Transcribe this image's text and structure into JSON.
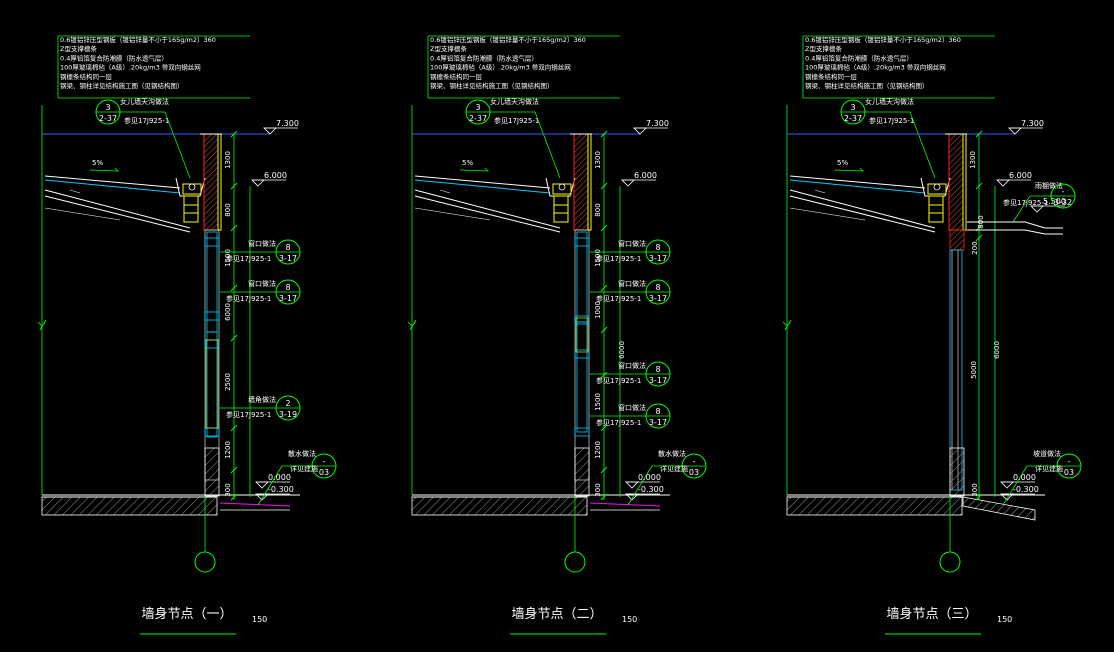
{
  "panels": [
    {
      "title": "墙身节点（一）",
      "scale": "150",
      "notes": [
        "0.6镀铝锌压型钢板（镀铝锌量不小于165g/m2）360",
        "Z型支撑檩条",
        "0.4厚铝箔复合防潮膜（防水透气层）",
        "100厚玻璃棉毡（A级）.20kg/m3  带双向钢丝网",
        "钢檩条结构同一层",
        "钢梁、钢柱详见结构施工图（见钢结构图）"
      ],
      "top_callout": {
        "num": "3",
        "ref": "2-37",
        "label": "女儿墙天沟做法",
        "see": "参见17J925-1"
      },
      "elevations": [
        "7.300",
        "6.000",
        "0.000",
        "-0.300"
      ],
      "slope": "5%",
      "dims": [
        "1300",
        "800",
        "1500",
        "6000",
        "2500",
        "1200",
        "300"
      ],
      "callouts": [
        {
          "label": "窗口做法",
          "num": "8",
          "ref": "3-17",
          "see": "参见17J925-1"
        },
        {
          "label": "窗口做法",
          "num": "8",
          "ref": "3-17",
          "see": "参见17J925-1"
        },
        {
          "label": "墙角做法",
          "num": "2",
          "ref": "3-19",
          "see": "参见17J925-1"
        }
      ],
      "bottom_callout": {
        "label1": "散水做法",
        "label2": "详见建施",
        "num": "-",
        "ref": "03"
      }
    },
    {
      "title": "墙身节点（二）",
      "scale": "150",
      "notes": [
        "0.6镀铝锌压型钢板（镀铝锌量不小于165g/m2）360",
        "Z型支撑檩条",
        "0.4厚铝箔复合防潮膜（防水透气层）",
        "100厚玻璃棉毡（A级）.20kg/m3  带双向钢丝网",
        "钢檩条结构同一层",
        "钢梁、钢柱详见结构施工图（见钢结构图）"
      ],
      "top_callout": {
        "num": "3",
        "ref": "2-37",
        "label": "女儿墙天沟做法",
        "see": "参见17J925-1"
      },
      "elevations": [
        "7.300",
        "6.000",
        "0.000",
        "-0.300"
      ],
      "slope": "5%",
      "dims": [
        "1300",
        "800",
        "1500",
        "1000",
        "6000",
        "1500",
        "1200",
        "300"
      ],
      "callouts": [
        {
          "label": "窗口做法",
          "num": "8",
          "ref": "3-17",
          "see": "参见17J925-1"
        },
        {
          "label": "窗口做法",
          "num": "8",
          "ref": "3-17",
          "see": "参见17J925-1"
        },
        {
          "label": "窗口做法",
          "num": "8",
          "ref": "3-17",
          "see": "参见17J925-1"
        },
        {
          "label": "窗口做法",
          "num": "8",
          "ref": "3-17",
          "see": "参见17J925-1"
        }
      ],
      "bottom_callout": {
        "label1": "散水做法",
        "label2": "详见建施",
        "num": "-",
        "ref": "03"
      }
    },
    {
      "title": "墙身节点（三）",
      "scale": "150",
      "notes": [
        "0.6镀铝锌压型钢板（镀铝锌量不小于165g/m2）360",
        "Z型支撑檩条",
        "0.4厚铝箔复合防潮膜（防水透气层）",
        "100厚玻璃棉毡（A级）.20kg/m3  带双向钢丝网",
        "钢檩条结构同一层",
        "钢梁、钢柱详见结构施工图（见钢结构图）"
      ],
      "top_callout": {
        "num": "3",
        "ref": "2-37",
        "label": "女儿墙天沟做法",
        "see": "参见17J925-1"
      },
      "elevations": [
        "7.300",
        "6.000",
        "5.500",
        "0.000",
        "-0.300"
      ],
      "slope": "5%",
      "dims": [
        "1300",
        "800",
        "200",
        "6000",
        "5000",
        "300"
      ],
      "callouts": [
        {
          "label": "雨棚做法",
          "num": "-",
          "ref": "3-32",
          "see": "参见17J925-1"
        }
      ],
      "bottom_callout": {
        "label1": "坡道做法",
        "label2": "详见建施",
        "num": "-",
        "ref": "03"
      }
    }
  ],
  "colors": {
    "background": "#000000",
    "green": "#00ff00",
    "blue": "#3060ff",
    "cyan": "#00c8ff",
    "red": "#ff2020",
    "yellow": "#ffff00",
    "white": "#ffffff",
    "magenta": "#ff00ff",
    "hatch": "#9a9a9a"
  }
}
